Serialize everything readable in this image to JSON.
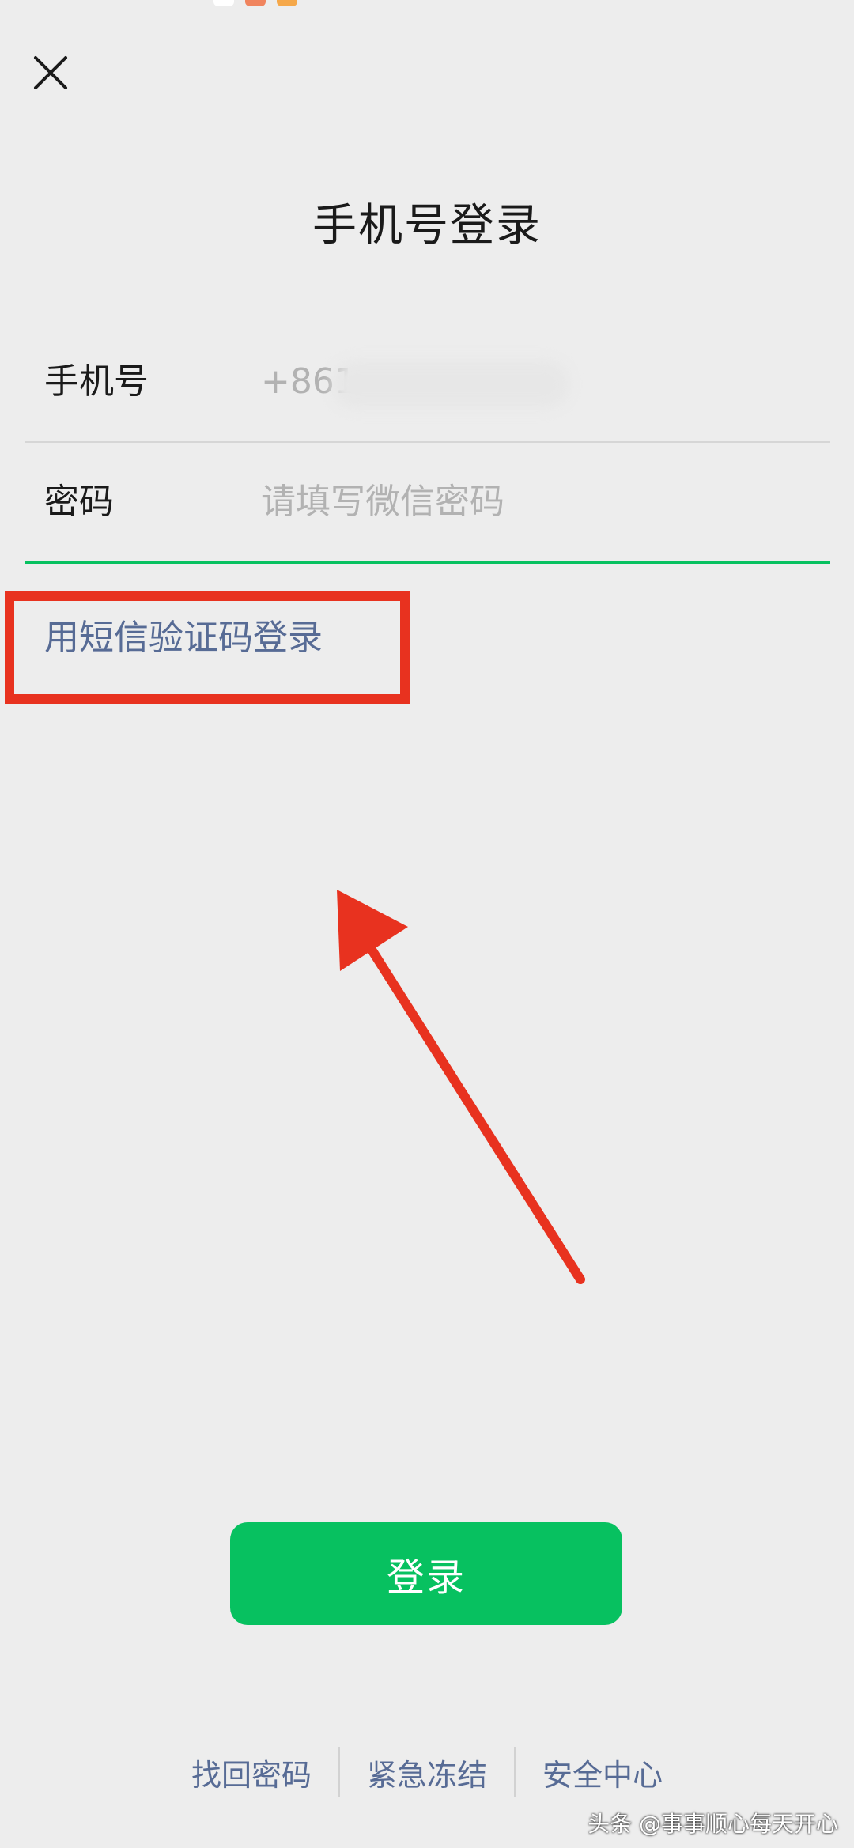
{
  "header": {
    "close_icon": "close-icon",
    "title": "手机号登录"
  },
  "form": {
    "phone_label": "手机号",
    "phone_value": "+861",
    "password_label": "密码",
    "password_placeholder": "请填写微信密码"
  },
  "sms_login_link": "用短信验证码登录",
  "login_button": "登录",
  "footer": {
    "links": [
      "找回密码",
      "紧急冻结",
      "安全中心"
    ]
  },
  "watermark": "头条 @事事顺心每天开心",
  "annotation": {
    "highlight_color": "#E8321F"
  },
  "colors": {
    "accent_green": "#07C160",
    "link_blue": "#576B95",
    "background": "#EDEDED"
  }
}
